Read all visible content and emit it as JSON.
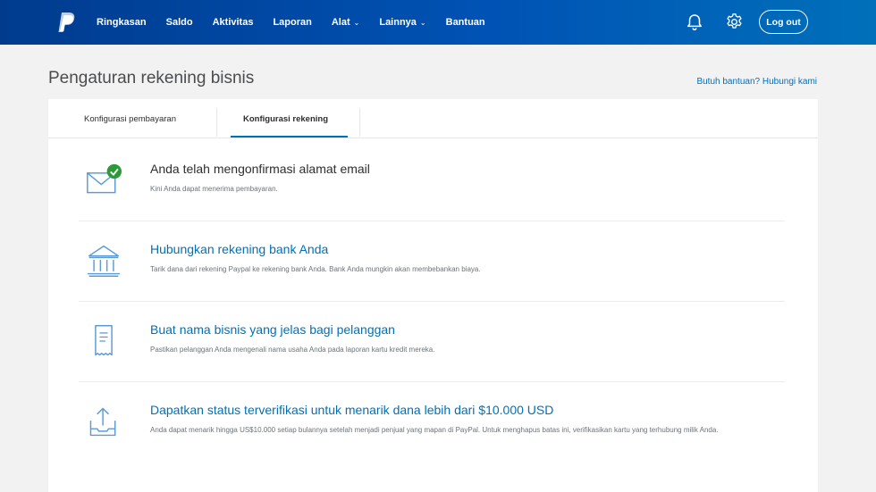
{
  "topbar": {
    "nav": [
      {
        "label": "Ringkasan",
        "has_caret": false
      },
      {
        "label": "Saldo",
        "has_caret": false
      },
      {
        "label": "Aktivitas",
        "has_caret": false
      },
      {
        "label": "Laporan",
        "has_caret": false
      },
      {
        "label": "Alat",
        "has_caret": true
      },
      {
        "label": "Lainnya",
        "has_caret": true
      },
      {
        "label": "Bantuan",
        "has_caret": false
      }
    ],
    "logout_label": "Log out",
    "icons": [
      "paypal-logo-icon",
      "bell-icon",
      "gear-icon",
      "chevron-down-icon"
    ],
    "colors": {
      "bar": "#003b8e",
      "accent": "#0070ba",
      "success": "#2d9a3a"
    }
  },
  "header": {
    "title": "Pengaturan rekening bisnis",
    "help_link": "Butuh bantuan? Hubungi kami"
  },
  "tabs": [
    {
      "label": "Konfigurasi pembayaran",
      "active": false
    },
    {
      "label": "Konfigurasi rekening",
      "active": true
    }
  ],
  "items": [
    {
      "icon": "envelope-check-icon",
      "title": "Anda telah mengonfirmasi alamat email",
      "desc": "Kini Anda dapat menerima pembayaran.",
      "status": "done"
    },
    {
      "icon": "bank-icon",
      "title": "Hubungkan rekening bank Anda",
      "desc": "Tarik dana dari rekening Paypal ke rekening bank Anda. Bank Anda mungkin akan membebankan biaya.",
      "status": "todo"
    },
    {
      "icon": "receipt-icon",
      "title": "Buat nama bisnis yang jelas bagi pelanggan",
      "desc": "Pastikan pelanggan Anda mengenali nama usaha Anda pada laporan kartu kredit mereka.",
      "status": "todo"
    },
    {
      "icon": "upload-tray-icon",
      "title": "Dapatkan status terverifikasi untuk menarik dana lebih dari $10.000 USD",
      "desc": "Anda dapat menarik hingga US$10.000 setiap bulannya setelah menjadi penjual yang mapan di PayPal. Untuk menghapus batas ini, verifikasikan kartu yang terhubung milik Anda.",
      "status": "todo"
    }
  ]
}
